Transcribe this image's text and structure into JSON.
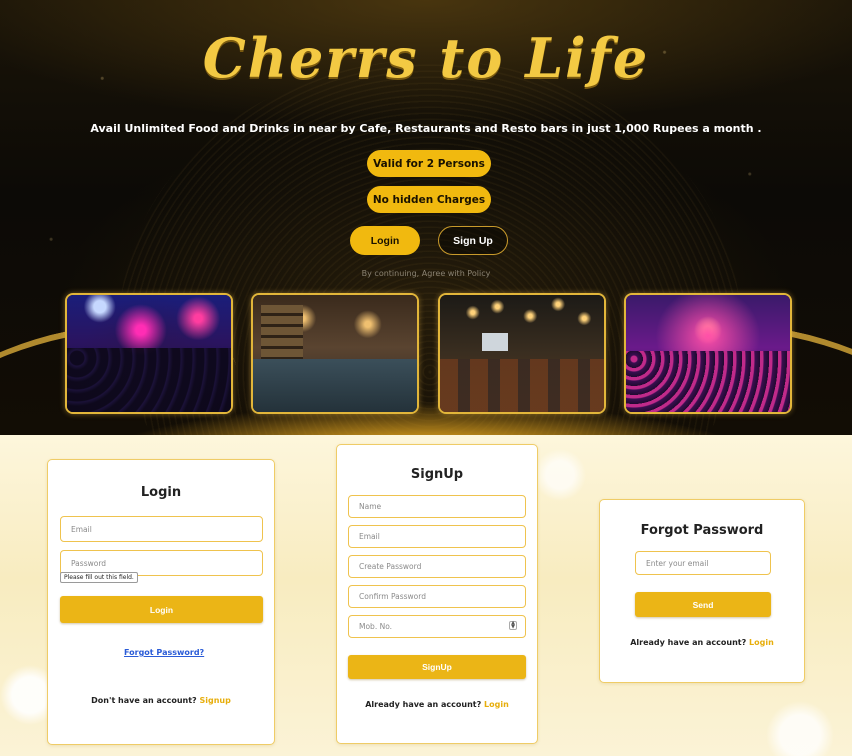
{
  "hero": {
    "brand": "Cherrs to Life",
    "tagline": "Avail Unlimited Food and Drinks in near by Cafe, Restaurants and Resto bars in just 1,000 Rupees a month .",
    "pill_persons": "Valid for 2 Persons",
    "pill_charges": "No hidden Charges",
    "login_label": "Login",
    "signup_label": "Sign Up",
    "policy": "By continuing, Agree with Policy",
    "photos": [
      "nightclub-icon",
      "cafe-interior-icon",
      "restobar-icon",
      "concert-stage-icon"
    ]
  },
  "login_card": {
    "title": "Login",
    "email_placeholder": "Email",
    "password_placeholder": "Password",
    "validation_tip": "Please fill out this field.",
    "button": "Login",
    "forgot_link": "Forgot Password?",
    "footer_text": "Don't have an account?",
    "footer_link": "Signup"
  },
  "signup_card": {
    "title": "SignUp",
    "name_placeholder": "Name",
    "email_placeholder": "Email",
    "create_password_placeholder": "Create Password",
    "confirm_password_placeholder": "Confirm Password",
    "mobile_placeholder": "Mob. No.",
    "button": "SignUp",
    "footer_text": "Already have an account?",
    "footer_link": "Login"
  },
  "forgot_card": {
    "title": "Forgot Password",
    "email_placeholder": "Enter your email",
    "button": "Send",
    "footer_text": "Already have an account?",
    "footer_link": "Login"
  },
  "colors": {
    "accent": "#F1B90F",
    "card_border": "#EFCC66",
    "link_blue": "#2A5BD7"
  }
}
